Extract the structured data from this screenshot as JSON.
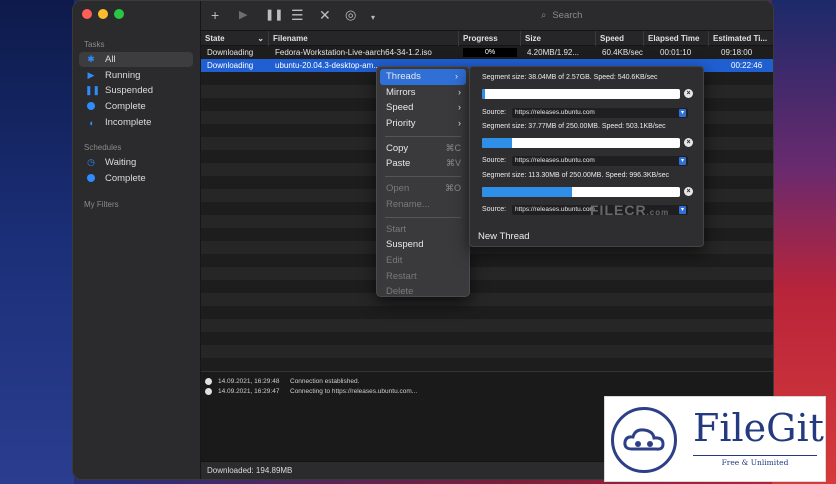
{
  "sidebar": {
    "tasks_header": "Tasks",
    "tasks": [
      {
        "label": "All",
        "icon": "asterisk-icon",
        "selected": true
      },
      {
        "label": "Running",
        "icon": "play-icon"
      },
      {
        "label": "Suspended",
        "icon": "pause-icon"
      },
      {
        "label": "Complete",
        "icon": "dot-icon"
      },
      {
        "label": "Incomplete",
        "icon": "moon-icon"
      }
    ],
    "schedules_header": "Schedules",
    "schedules": [
      {
        "label": "Waiting",
        "icon": "clock-icon"
      },
      {
        "label": "Complete",
        "icon": "dot-icon"
      }
    ],
    "filters_header": "My Filters"
  },
  "toolbar": {
    "search_placeholder": "Search"
  },
  "table": {
    "columns": [
      "State",
      "Filename",
      "Progress",
      "Size",
      "Speed",
      "Elapsed Time",
      "Estimated Ti..."
    ],
    "rows": [
      {
        "state": "Downloading",
        "filename": "Fedora-Workstation-Live-aarch64-34-1.2.iso",
        "progress": "0%",
        "progress_value": 0,
        "size": "4.20MB/1.92...",
        "speed": "60.4KB/sec",
        "elapsed": "00:01:10",
        "estimated": "09:18:00",
        "selected": false
      },
      {
        "state": "Downloading",
        "filename": "ubuntu-20.04.3-desktop-am...",
        "progress": "",
        "progress_value": 0.1,
        "size": "",
        "speed": "",
        "elapsed": "",
        "estimated": "00:22:46",
        "selected": true
      }
    ]
  },
  "context_menu": {
    "items": [
      {
        "label": "Threads",
        "submenu": true,
        "highlighted": true
      },
      {
        "label": "Mirrors",
        "submenu": true
      },
      {
        "label": "Speed",
        "submenu": true
      },
      {
        "label": "Priority",
        "submenu": true
      },
      {
        "separator": true
      },
      {
        "label": "Copy",
        "shortcut": "⌘C"
      },
      {
        "label": "Paste",
        "shortcut": "⌘V"
      },
      {
        "separator": true
      },
      {
        "label": "Open",
        "shortcut": "⌘O",
        "disabled": true
      },
      {
        "label": "Rename...",
        "disabled": true
      },
      {
        "separator": true
      },
      {
        "label": "Start",
        "disabled": true
      },
      {
        "label": "Suspend"
      },
      {
        "label": "Edit",
        "disabled": true
      },
      {
        "label": "Restart",
        "disabled": true
      },
      {
        "label": "Delete",
        "disabled": true
      }
    ]
  },
  "threads_panel": {
    "segments": [
      {
        "size_text": "Segment size: 38.04MB of 2.57GB. Speed: 540.6KB/sec",
        "progress": 0.015,
        "source_label": "Source:",
        "source": "https://releases.ubuntu.com"
      },
      {
        "size_text": "Segment size: 37.77MB of 250.00MB. Speed: 503.1KB/sec",
        "progress": 0.151,
        "source_label": "Source:",
        "source": "https://releases.ubuntu.com"
      },
      {
        "size_text": "Segment size: 113.30MB of 250.00MB. Speed: 996.3KB/sec",
        "progress": 0.453,
        "source_label": "Source:",
        "source": "https://releases.ubuntu.com"
      }
    ],
    "new_thread_label": "New Thread"
  },
  "log": [
    {
      "time": "14.09.2021, 16:29:48",
      "message": "Connection established."
    },
    {
      "time": "14.09.2021, 16:29:47",
      "message": "Connecting to https://releases.ubuntu.com..."
    }
  ],
  "status": {
    "downloaded": "Downloaded: 194.89MB"
  },
  "watermarks": {
    "filecr": "FILECR",
    "filecr_suffix": ".com",
    "filegit_title": "FileGit",
    "filegit_tag": "Free & Unlimited"
  },
  "colors": {
    "accent": "#2f8cff",
    "selection": "#1f5fd1",
    "menu_highlight": "#2f6fd6"
  }
}
